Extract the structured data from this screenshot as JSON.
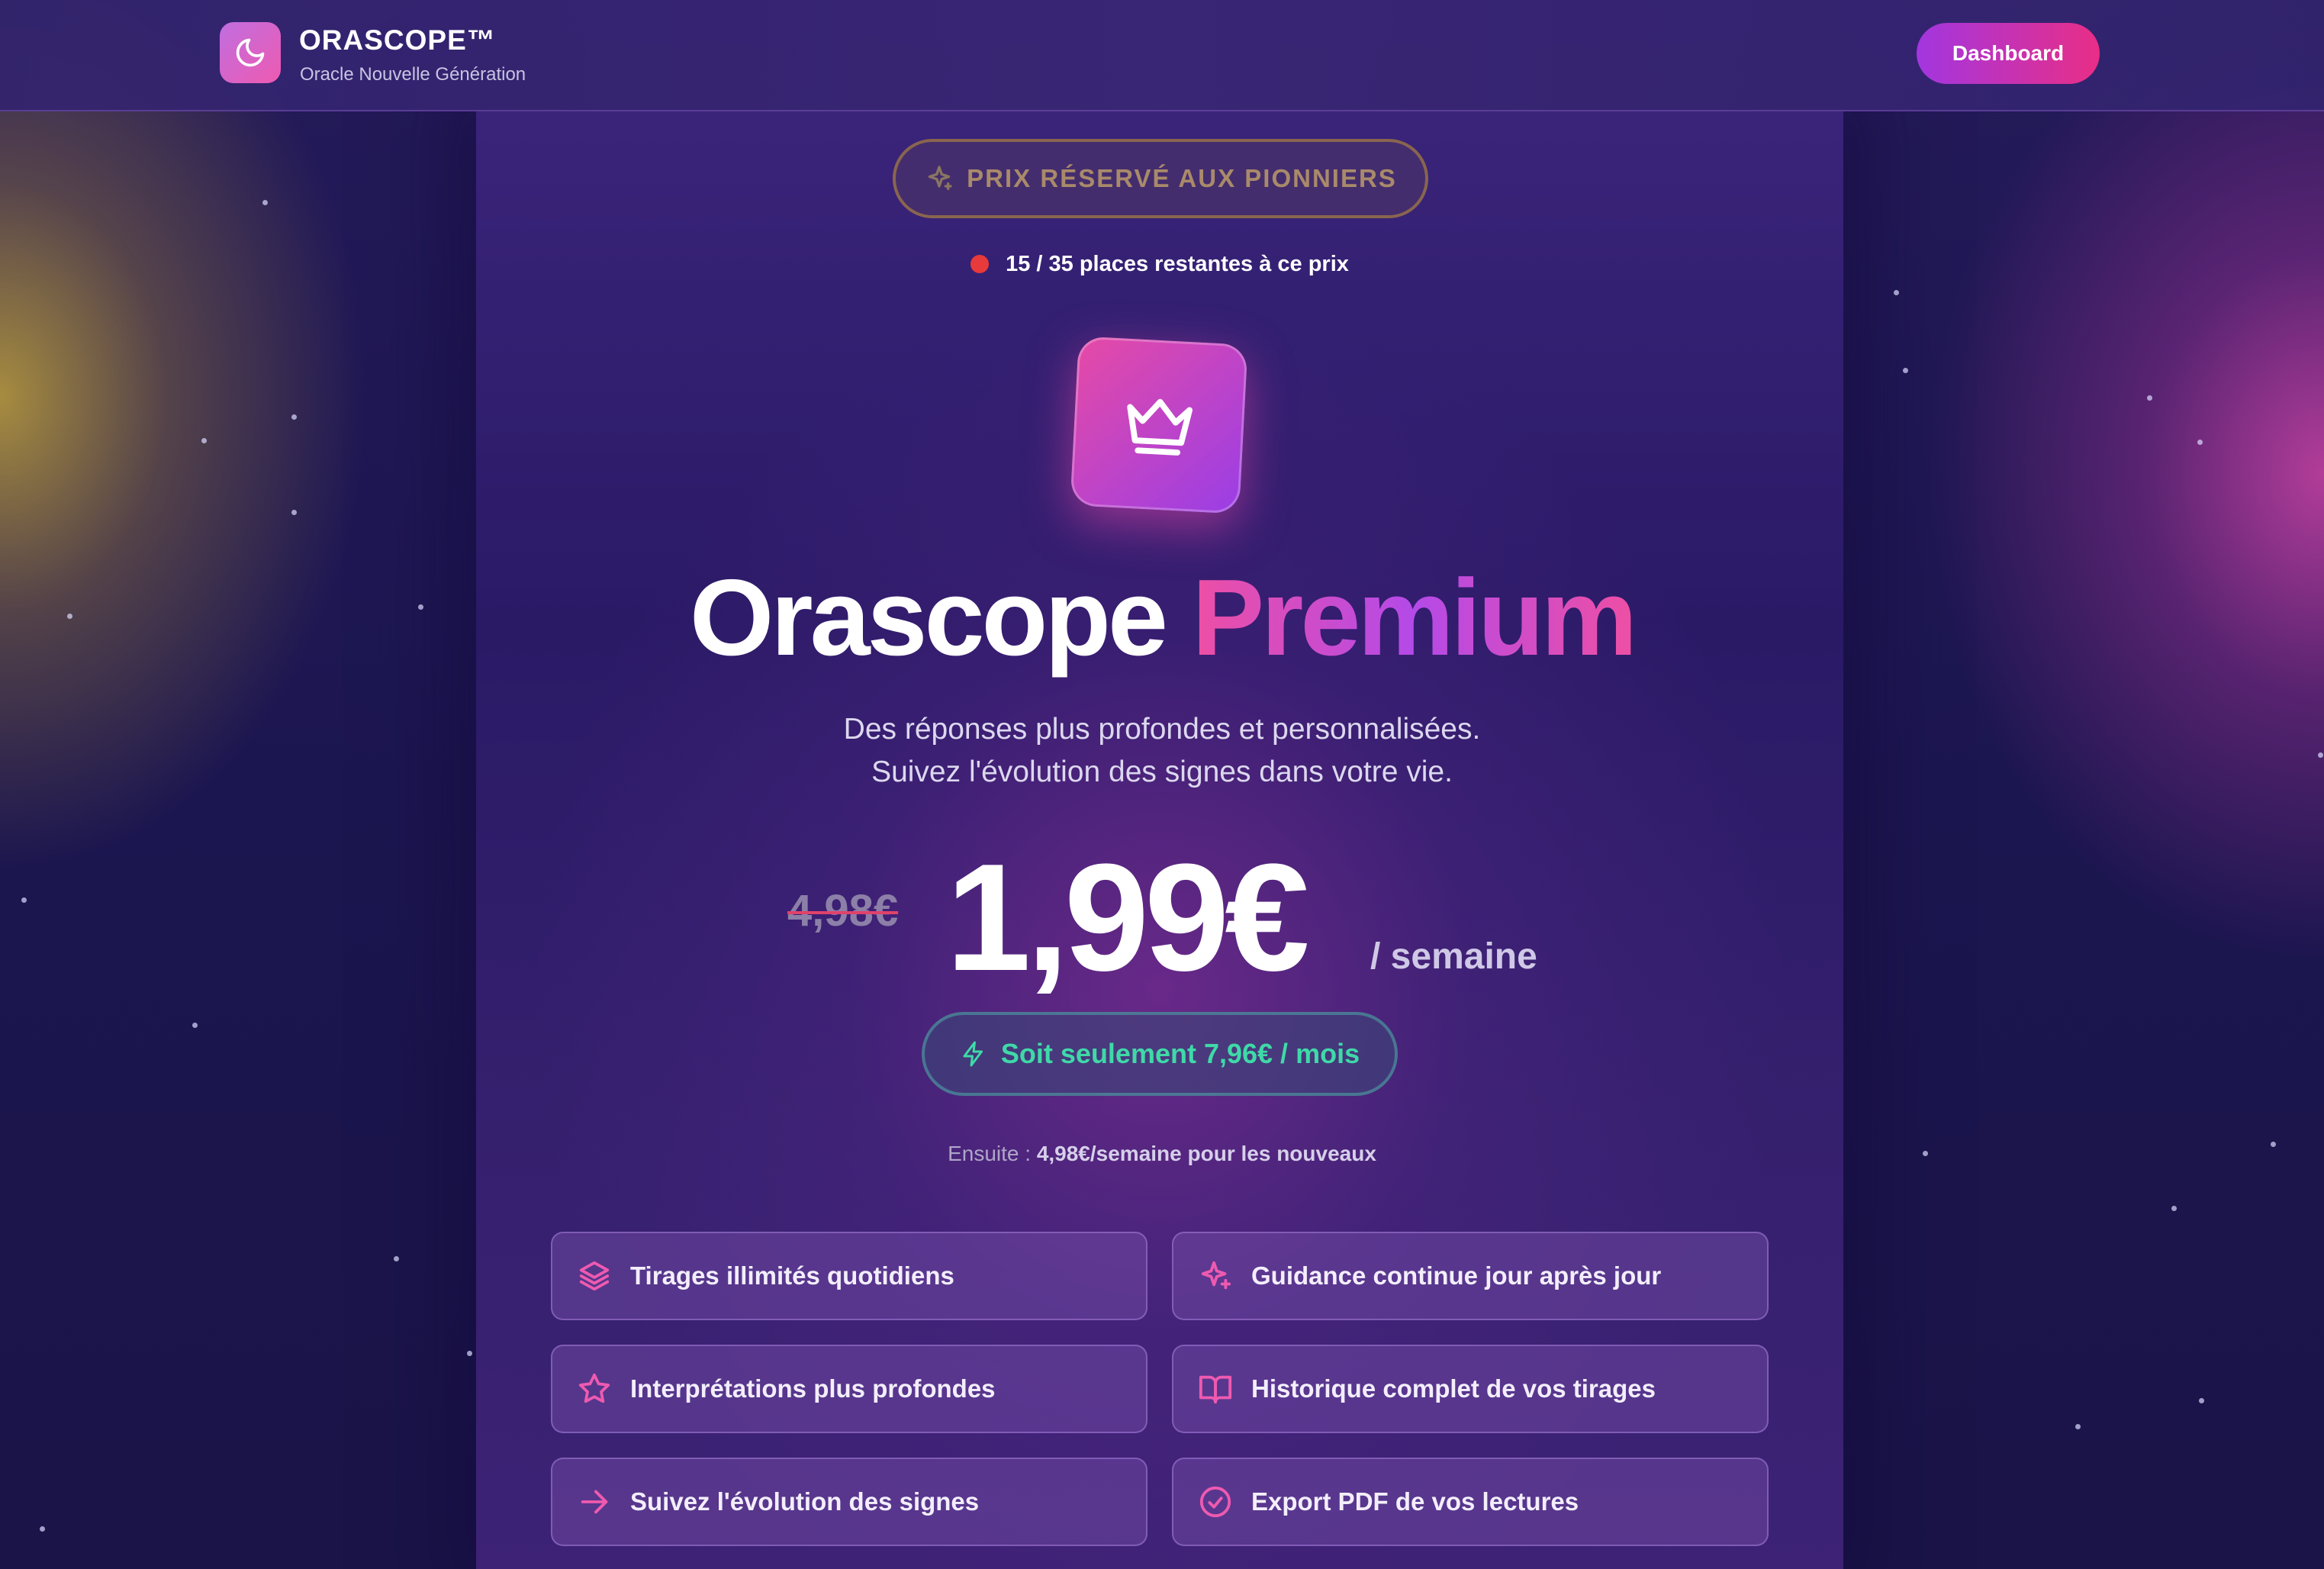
{
  "header": {
    "brand_name": "ORASCOPE™",
    "brand_subtitle": "Oracle Nouvelle Génération",
    "dashboard_label": "Dashboard"
  },
  "hero": {
    "pioneer_badge": "PRIX RÉSERVÉ AUX PIONNIERS",
    "places_remaining": "15 / 35 places restantes à ce prix",
    "title_part1": "Orascope",
    "title_part2": "Premium",
    "subtitle_line1": "Des réponses plus profondes et personnalisées.",
    "subtitle_line2": "Suivez l'évolution des signes dans votre vie."
  },
  "pricing": {
    "old_price": "4,98€",
    "price": "1,99€",
    "period": "/ semaine",
    "monthly_note": "Soit seulement 7,96€ / mois",
    "then_label": "Ensuite :",
    "then_value": "4,98€/semaine pour les nouveaux"
  },
  "features": [
    {
      "label": "Tirages illimités quotidiens",
      "icon": "layers-icon"
    },
    {
      "label": "Guidance continue jour après jour",
      "icon": "sparkles-icon"
    },
    {
      "label": "Interprétations plus profondes",
      "icon": "star-icon"
    },
    {
      "label": "Historique complet de vos tirages",
      "icon": "book-icon"
    },
    {
      "label": "Suivez l'évolution des signes",
      "icon": "arrow-right-icon"
    },
    {
      "label": "Export PDF de vos lectures",
      "icon": "check-circle-icon"
    }
  ],
  "colors": {
    "accent_pink": "#ee4fa4",
    "accent_purple": "#a236e0",
    "monthly_green": "#3fd9a8",
    "alert_red": "#e83a3a"
  }
}
